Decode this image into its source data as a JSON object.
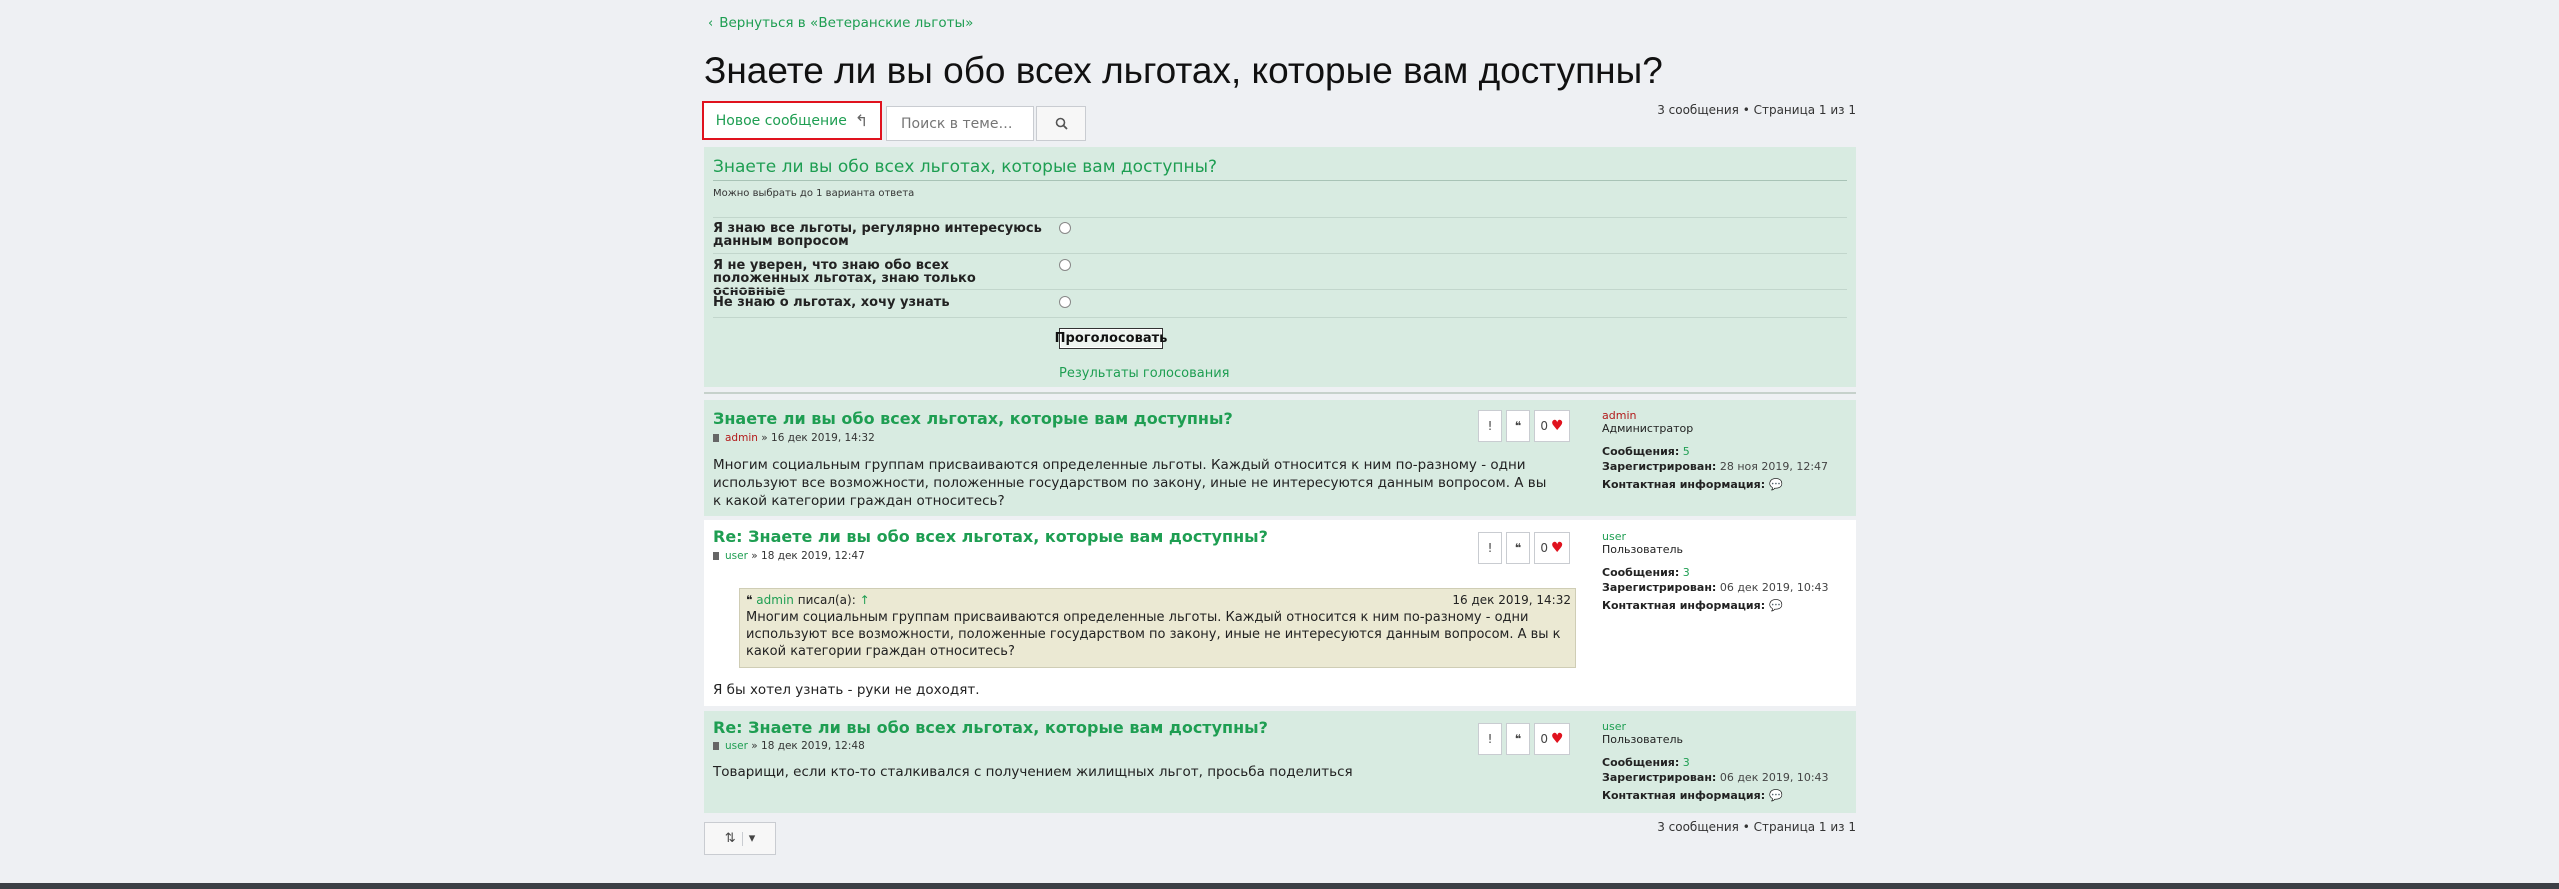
{
  "nav": {
    "back_label": "Вернуться в «Ветеранские льготы»"
  },
  "topic": {
    "title": "Знаете ли вы обо всех льготах, которые вам доступны?"
  },
  "actions": {
    "new_post_label": "Новое сообщение",
    "search_placeholder": "Поиск в теме…"
  },
  "pagination": {
    "text": "3 сообщения • Страница 1 из 1"
  },
  "poll": {
    "title": "Знаете ли вы обо всех льготах, которые вам доступны?",
    "hint": "Можно выбрать до 1 варианта ответа",
    "options": [
      "Я знаю все льготы, регулярно интересуюсь данным вопросом",
      "Я не уверен, что знаю обо всех положенных льготах, знаю только основные",
      "Не знаю о льготах, хочу узнать"
    ],
    "vote_label": "Проголосовать",
    "results_label": "Результаты голосования"
  },
  "posts": [
    {
      "title": "Знаете ли вы обо всех льготах, которые вам доступны?",
      "author": "admin",
      "date": "» 16 дек 2019, 14:32",
      "body": "Многим социальным группам присваиваются определенные льготы. Каждый относится к ним по-разному - одни используют все возможности, положенные государством по закону, иные не интересуются данным вопросом. А вы к какой категории граждан относитесь?",
      "likes": "0",
      "profile": {
        "name": "admin",
        "rank": "Администратор",
        "posts_label": "Сообщения:",
        "posts": "5",
        "reg_label": "Зарегистрирован:",
        "reg": "28 ноя 2019, 12:47",
        "contact_label": "Контактная информация:"
      }
    },
    {
      "title": "Re: Знаете ли вы обо всех льготах, которые вам доступны?",
      "author": "user",
      "date": "» 18 дек 2019, 12:47",
      "quote": {
        "author": "admin",
        "wrote": "писал(а):",
        "arrow": "↑",
        "date": "16 дек 2019, 14:32",
        "text": "Многим социальным группам присваиваются определенные льготы. Каждый относится к ним по-разному - одни используют все возможности, положенные государством по закону, иные не интересуются данным вопросом. А вы к какой категории граждан относитесь?"
      },
      "body": "Я бы хотел узнать - руки не доходят.",
      "likes": "0",
      "profile": {
        "name": "user",
        "rank": "Пользователь",
        "posts_label": "Сообщения:",
        "posts": "3",
        "reg_label": "Зарегистрирован:",
        "reg": "06 дек 2019, 10:43",
        "contact_label": "Контактная информация:"
      }
    },
    {
      "title": "Re: Знаете ли вы обо всех льготах, которые вам доступны?",
      "author": "user",
      "date": "» 18 дек 2019, 12:48",
      "body": "Товарищи, если кто-то сталкивался с получением жилищных льгот, просьба поделиться",
      "likes": "0",
      "profile": {
        "name": "user",
        "rank": "Пользователь",
        "posts_label": "Сообщения:",
        "posts": "3",
        "reg_label": "Зарегистрирован:",
        "reg": "06 дек 2019, 10:43",
        "contact_label": "Контактная информация:"
      }
    }
  ],
  "colors": {
    "accent": "#1e9e52",
    "post_bg": "#d8ebe1",
    "highlight": "#e0121e",
    "admin": "#b31b1b"
  }
}
